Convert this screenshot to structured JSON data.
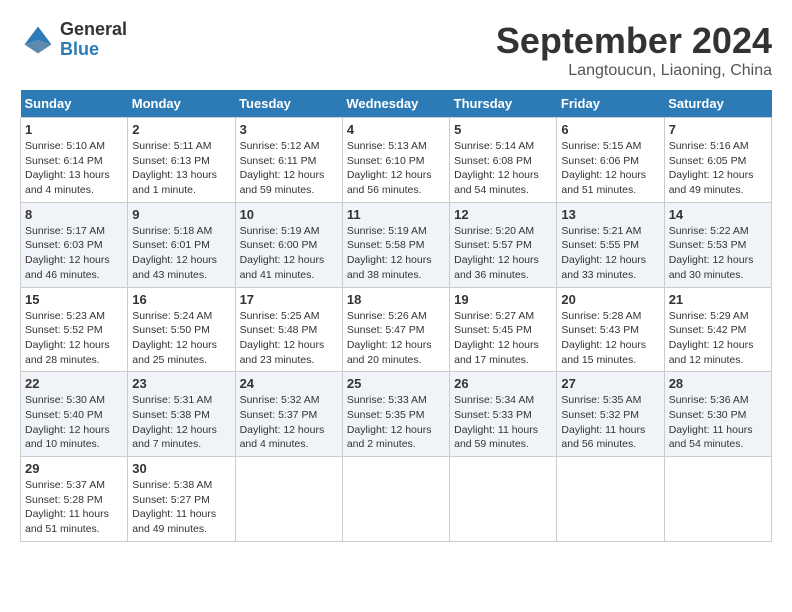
{
  "header": {
    "logo_general": "General",
    "logo_blue": "Blue",
    "month_title": "September 2024",
    "location": "Langtoucun, Liaoning, China"
  },
  "weekdays": [
    "Sunday",
    "Monday",
    "Tuesday",
    "Wednesday",
    "Thursday",
    "Friday",
    "Saturday"
  ],
  "weeks": [
    [
      {
        "day": "1",
        "info": "Sunrise: 5:10 AM\nSunset: 6:14 PM\nDaylight: 13 hours\nand 4 minutes."
      },
      {
        "day": "2",
        "info": "Sunrise: 5:11 AM\nSunset: 6:13 PM\nDaylight: 13 hours\nand 1 minute."
      },
      {
        "day": "3",
        "info": "Sunrise: 5:12 AM\nSunset: 6:11 PM\nDaylight: 12 hours\nand 59 minutes."
      },
      {
        "day": "4",
        "info": "Sunrise: 5:13 AM\nSunset: 6:10 PM\nDaylight: 12 hours\nand 56 minutes."
      },
      {
        "day": "5",
        "info": "Sunrise: 5:14 AM\nSunset: 6:08 PM\nDaylight: 12 hours\nand 54 minutes."
      },
      {
        "day": "6",
        "info": "Sunrise: 5:15 AM\nSunset: 6:06 PM\nDaylight: 12 hours\nand 51 minutes."
      },
      {
        "day": "7",
        "info": "Sunrise: 5:16 AM\nSunset: 6:05 PM\nDaylight: 12 hours\nand 49 minutes."
      }
    ],
    [
      {
        "day": "8",
        "info": "Sunrise: 5:17 AM\nSunset: 6:03 PM\nDaylight: 12 hours\nand 46 minutes."
      },
      {
        "day": "9",
        "info": "Sunrise: 5:18 AM\nSunset: 6:01 PM\nDaylight: 12 hours\nand 43 minutes."
      },
      {
        "day": "10",
        "info": "Sunrise: 5:19 AM\nSunset: 6:00 PM\nDaylight: 12 hours\nand 41 minutes."
      },
      {
        "day": "11",
        "info": "Sunrise: 5:19 AM\nSunset: 5:58 PM\nDaylight: 12 hours\nand 38 minutes."
      },
      {
        "day": "12",
        "info": "Sunrise: 5:20 AM\nSunset: 5:57 PM\nDaylight: 12 hours\nand 36 minutes."
      },
      {
        "day": "13",
        "info": "Sunrise: 5:21 AM\nSunset: 5:55 PM\nDaylight: 12 hours\nand 33 minutes."
      },
      {
        "day": "14",
        "info": "Sunrise: 5:22 AM\nSunset: 5:53 PM\nDaylight: 12 hours\nand 30 minutes."
      }
    ],
    [
      {
        "day": "15",
        "info": "Sunrise: 5:23 AM\nSunset: 5:52 PM\nDaylight: 12 hours\nand 28 minutes."
      },
      {
        "day": "16",
        "info": "Sunrise: 5:24 AM\nSunset: 5:50 PM\nDaylight: 12 hours\nand 25 minutes."
      },
      {
        "day": "17",
        "info": "Sunrise: 5:25 AM\nSunset: 5:48 PM\nDaylight: 12 hours\nand 23 minutes."
      },
      {
        "day": "18",
        "info": "Sunrise: 5:26 AM\nSunset: 5:47 PM\nDaylight: 12 hours\nand 20 minutes."
      },
      {
        "day": "19",
        "info": "Sunrise: 5:27 AM\nSunset: 5:45 PM\nDaylight: 12 hours\nand 17 minutes."
      },
      {
        "day": "20",
        "info": "Sunrise: 5:28 AM\nSunset: 5:43 PM\nDaylight: 12 hours\nand 15 minutes."
      },
      {
        "day": "21",
        "info": "Sunrise: 5:29 AM\nSunset: 5:42 PM\nDaylight: 12 hours\nand 12 minutes."
      }
    ],
    [
      {
        "day": "22",
        "info": "Sunrise: 5:30 AM\nSunset: 5:40 PM\nDaylight: 12 hours\nand 10 minutes."
      },
      {
        "day": "23",
        "info": "Sunrise: 5:31 AM\nSunset: 5:38 PM\nDaylight: 12 hours\nand 7 minutes."
      },
      {
        "day": "24",
        "info": "Sunrise: 5:32 AM\nSunset: 5:37 PM\nDaylight: 12 hours\nand 4 minutes."
      },
      {
        "day": "25",
        "info": "Sunrise: 5:33 AM\nSunset: 5:35 PM\nDaylight: 12 hours\nand 2 minutes."
      },
      {
        "day": "26",
        "info": "Sunrise: 5:34 AM\nSunset: 5:33 PM\nDaylight: 11 hours\nand 59 minutes."
      },
      {
        "day": "27",
        "info": "Sunrise: 5:35 AM\nSunset: 5:32 PM\nDaylight: 11 hours\nand 56 minutes."
      },
      {
        "day": "28",
        "info": "Sunrise: 5:36 AM\nSunset: 5:30 PM\nDaylight: 11 hours\nand 54 minutes."
      }
    ],
    [
      {
        "day": "29",
        "info": "Sunrise: 5:37 AM\nSunset: 5:28 PM\nDaylight: 11 hours\nand 51 minutes."
      },
      {
        "day": "30",
        "info": "Sunrise: 5:38 AM\nSunset: 5:27 PM\nDaylight: 11 hours\nand 49 minutes."
      },
      {
        "day": "",
        "info": ""
      },
      {
        "day": "",
        "info": ""
      },
      {
        "day": "",
        "info": ""
      },
      {
        "day": "",
        "info": ""
      },
      {
        "day": "",
        "info": ""
      }
    ]
  ]
}
